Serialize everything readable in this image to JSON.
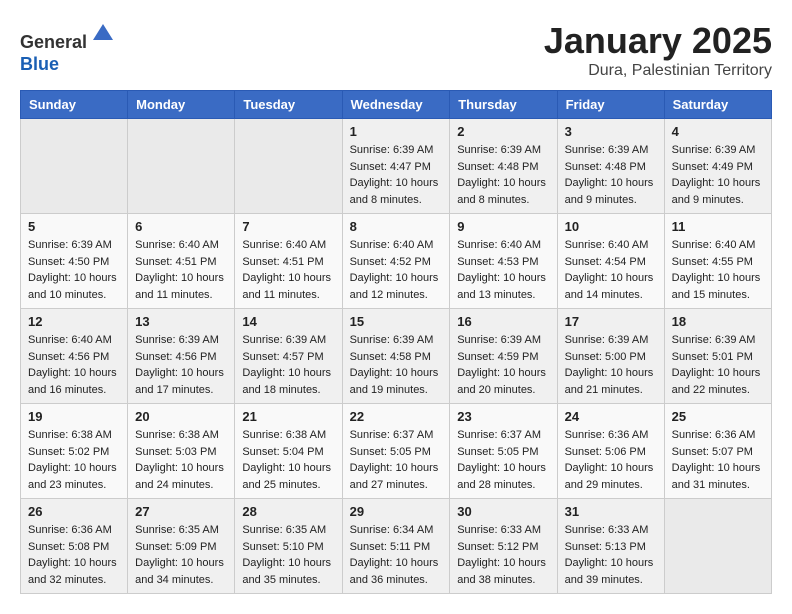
{
  "header": {
    "logo_line1": "General",
    "logo_line2": "Blue",
    "month_title": "January 2025",
    "location": "Dura, Palestinian Territory"
  },
  "days_of_week": [
    "Sunday",
    "Monday",
    "Tuesday",
    "Wednesday",
    "Thursday",
    "Friday",
    "Saturday"
  ],
  "weeks": [
    {
      "days": [
        {
          "num": "",
          "empty": true
        },
        {
          "num": "",
          "empty": true
        },
        {
          "num": "",
          "empty": true
        },
        {
          "num": "1",
          "sunrise": "6:39 AM",
          "sunset": "4:47 PM",
          "daylight": "10 hours and 8 minutes."
        },
        {
          "num": "2",
          "sunrise": "6:39 AM",
          "sunset": "4:48 PM",
          "daylight": "10 hours and 8 minutes."
        },
        {
          "num": "3",
          "sunrise": "6:39 AM",
          "sunset": "4:48 PM",
          "daylight": "10 hours and 9 minutes."
        },
        {
          "num": "4",
          "sunrise": "6:39 AM",
          "sunset": "4:49 PM",
          "daylight": "10 hours and 9 minutes."
        }
      ]
    },
    {
      "days": [
        {
          "num": "5",
          "sunrise": "6:39 AM",
          "sunset": "4:50 PM",
          "daylight": "10 hours and 10 minutes."
        },
        {
          "num": "6",
          "sunrise": "6:40 AM",
          "sunset": "4:51 PM",
          "daylight": "10 hours and 11 minutes."
        },
        {
          "num": "7",
          "sunrise": "6:40 AM",
          "sunset": "4:51 PM",
          "daylight": "10 hours and 11 minutes."
        },
        {
          "num": "8",
          "sunrise": "6:40 AM",
          "sunset": "4:52 PM",
          "daylight": "10 hours and 12 minutes."
        },
        {
          "num": "9",
          "sunrise": "6:40 AM",
          "sunset": "4:53 PM",
          "daylight": "10 hours and 13 minutes."
        },
        {
          "num": "10",
          "sunrise": "6:40 AM",
          "sunset": "4:54 PM",
          "daylight": "10 hours and 14 minutes."
        },
        {
          "num": "11",
          "sunrise": "6:40 AM",
          "sunset": "4:55 PM",
          "daylight": "10 hours and 15 minutes."
        }
      ]
    },
    {
      "days": [
        {
          "num": "12",
          "sunrise": "6:40 AM",
          "sunset": "4:56 PM",
          "daylight": "10 hours and 16 minutes."
        },
        {
          "num": "13",
          "sunrise": "6:39 AM",
          "sunset": "4:56 PM",
          "daylight": "10 hours and 17 minutes."
        },
        {
          "num": "14",
          "sunrise": "6:39 AM",
          "sunset": "4:57 PM",
          "daylight": "10 hours and 18 minutes."
        },
        {
          "num": "15",
          "sunrise": "6:39 AM",
          "sunset": "4:58 PM",
          "daylight": "10 hours and 19 minutes."
        },
        {
          "num": "16",
          "sunrise": "6:39 AM",
          "sunset": "4:59 PM",
          "daylight": "10 hours and 20 minutes."
        },
        {
          "num": "17",
          "sunrise": "6:39 AM",
          "sunset": "5:00 PM",
          "daylight": "10 hours and 21 minutes."
        },
        {
          "num": "18",
          "sunrise": "6:39 AM",
          "sunset": "5:01 PM",
          "daylight": "10 hours and 22 minutes."
        }
      ]
    },
    {
      "days": [
        {
          "num": "19",
          "sunrise": "6:38 AM",
          "sunset": "5:02 PM",
          "daylight": "10 hours and 23 minutes."
        },
        {
          "num": "20",
          "sunrise": "6:38 AM",
          "sunset": "5:03 PM",
          "daylight": "10 hours and 24 minutes."
        },
        {
          "num": "21",
          "sunrise": "6:38 AM",
          "sunset": "5:04 PM",
          "daylight": "10 hours and 25 minutes."
        },
        {
          "num": "22",
          "sunrise": "6:37 AM",
          "sunset": "5:05 PM",
          "daylight": "10 hours and 27 minutes."
        },
        {
          "num": "23",
          "sunrise": "6:37 AM",
          "sunset": "5:05 PM",
          "daylight": "10 hours and 28 minutes."
        },
        {
          "num": "24",
          "sunrise": "6:36 AM",
          "sunset": "5:06 PM",
          "daylight": "10 hours and 29 minutes."
        },
        {
          "num": "25",
          "sunrise": "6:36 AM",
          "sunset": "5:07 PM",
          "daylight": "10 hours and 31 minutes."
        }
      ]
    },
    {
      "days": [
        {
          "num": "26",
          "sunrise": "6:36 AM",
          "sunset": "5:08 PM",
          "daylight": "10 hours and 32 minutes."
        },
        {
          "num": "27",
          "sunrise": "6:35 AM",
          "sunset": "5:09 PM",
          "daylight": "10 hours and 34 minutes."
        },
        {
          "num": "28",
          "sunrise": "6:35 AM",
          "sunset": "5:10 PM",
          "daylight": "10 hours and 35 minutes."
        },
        {
          "num": "29",
          "sunrise": "6:34 AM",
          "sunset": "5:11 PM",
          "daylight": "10 hours and 36 minutes."
        },
        {
          "num": "30",
          "sunrise": "6:33 AM",
          "sunset": "5:12 PM",
          "daylight": "10 hours and 38 minutes."
        },
        {
          "num": "31",
          "sunrise": "6:33 AM",
          "sunset": "5:13 PM",
          "daylight": "10 hours and 39 minutes."
        },
        {
          "num": "",
          "empty": true
        }
      ]
    }
  ],
  "labels": {
    "sunrise_prefix": "Sunrise: ",
    "sunset_prefix": "Sunset: ",
    "daylight_prefix": "Daylight: "
  }
}
